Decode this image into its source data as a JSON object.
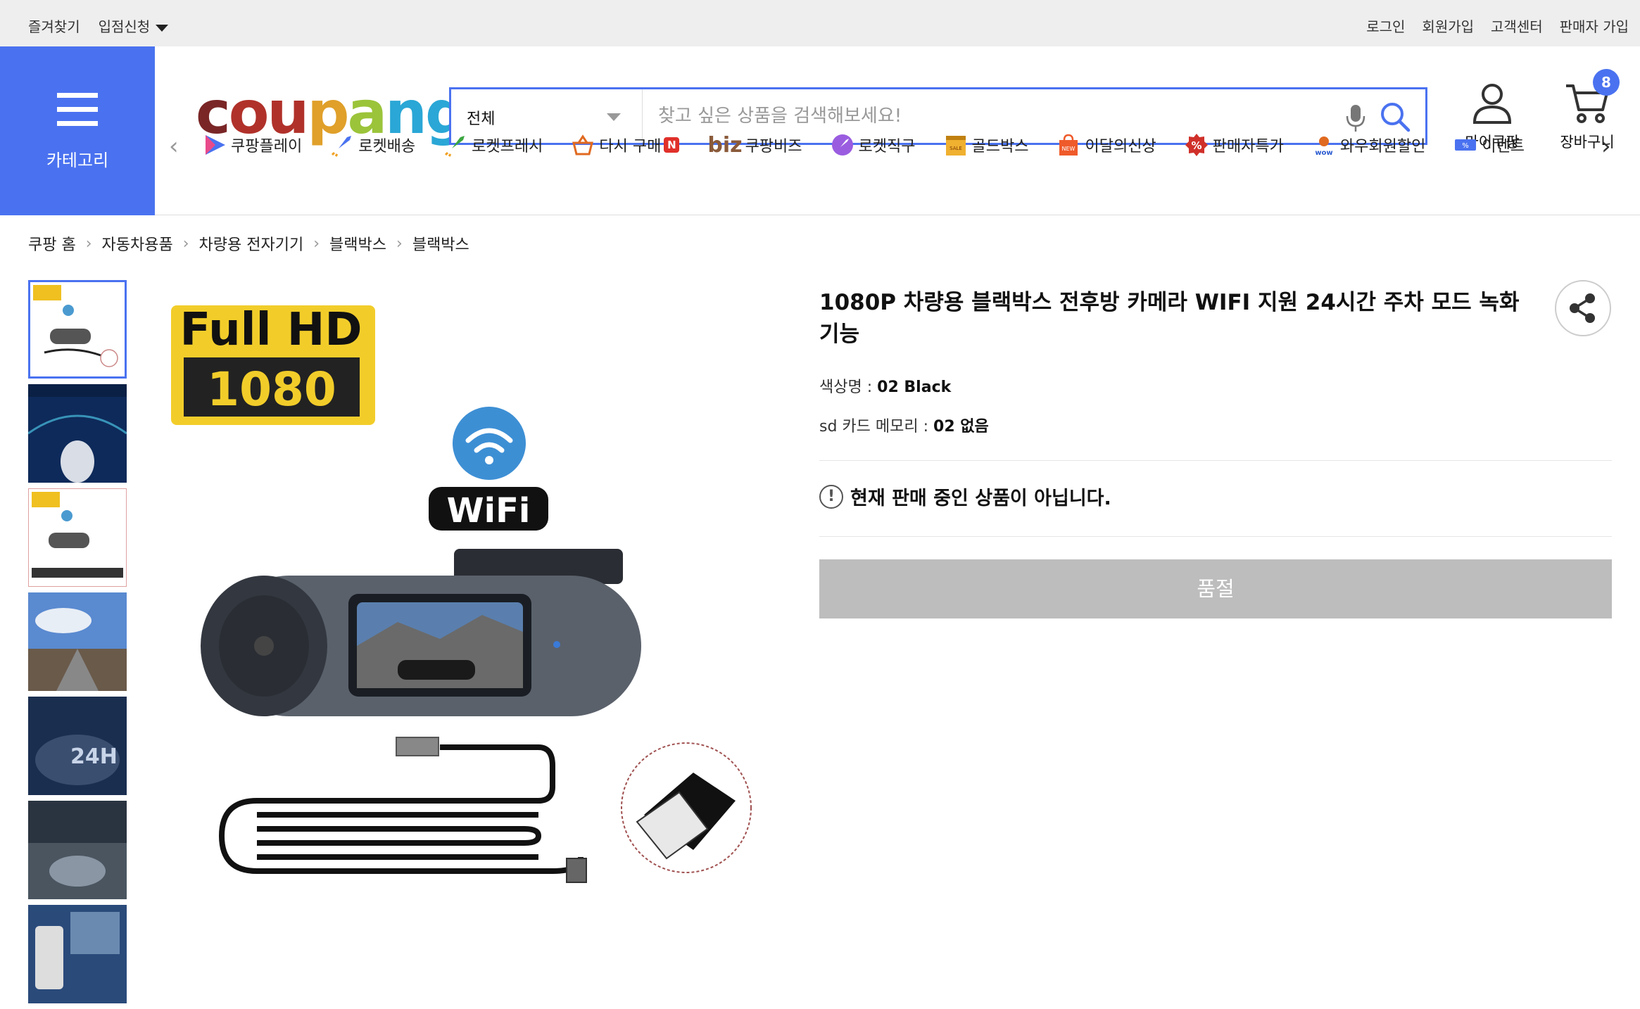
{
  "topbar": {
    "favorites": "즐겨찾기",
    "vendor_apply": "입점신청",
    "login": "로그인",
    "signup": "회원가입",
    "customer_center": "고객센터",
    "seller_signup": "판매자 가입"
  },
  "header": {
    "category_label": "카테고리",
    "logo_text": "coupang",
    "search": {
      "scope": "전체",
      "placeholder": "찾고 싶은 상품을 검색해보세요!"
    },
    "my_coupang": "마이쿠팡",
    "cart_label": "장바구니",
    "cart_count": "8",
    "accent_color": "#4a72f0"
  },
  "nav": {
    "items": [
      {
        "label": "쿠팡플레이",
        "icon": "play-icon"
      },
      {
        "label": "로켓배송",
        "icon": "rocket-icon"
      },
      {
        "label": "로켓프레시",
        "icon": "rocket-fresh-icon"
      },
      {
        "label": "다시 구매",
        "icon": "basket-icon",
        "badge": "N"
      },
      {
        "label": "쿠팡비즈",
        "icon": "biz-logo",
        "prefix": "biz"
      },
      {
        "label": "로켓직구",
        "icon": "rocket-global-icon"
      },
      {
        "label": "골드박스",
        "icon": "goldbox-icon"
      },
      {
        "label": "이달의신상",
        "icon": "new-bag-icon"
      },
      {
        "label": "판매자특가",
        "icon": "percent-icon"
      },
      {
        "label": "와우회원할인",
        "icon": "wow-icon"
      },
      {
        "label": "이벤트",
        "icon": "event-icon"
      }
    ]
  },
  "breadcrumb": [
    "쿠팡 홈",
    "자동차용품",
    "차량용 전자기기",
    "블랙박스",
    "블랙박스"
  ],
  "product": {
    "title": "1080P 차량용 블랙박스 전후방 카메라 WIFI 지원 24시간 주차 모드 녹화 기능",
    "options": [
      {
        "name": "색상명",
        "value": "02 Black"
      },
      {
        "name": "sd 카드 메모리",
        "value": "02 없음"
      }
    ],
    "notice": "현재 판매 중인 상품이 아닙니다.",
    "button": "품절",
    "image_badge_line1": "Full HD",
    "image_badge_line2": "1080",
    "image_wifi_text": "WiFi"
  }
}
